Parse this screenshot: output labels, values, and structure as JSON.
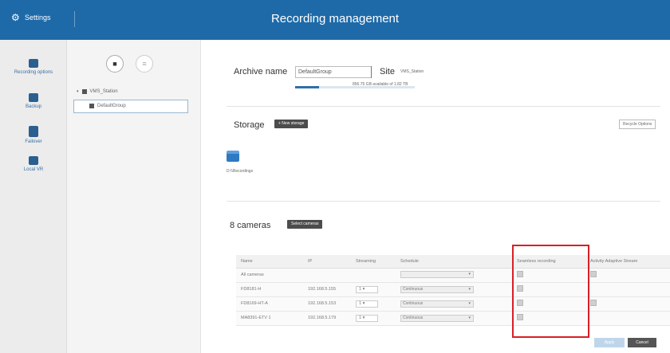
{
  "topbar": {
    "brand_label": "Settings",
    "title": "Recording management"
  },
  "sidebar": {
    "items": [
      {
        "label": "Recording options",
        "icon": "calendar-icon"
      },
      {
        "label": "Backup",
        "icon": "backup-icon"
      },
      {
        "label": "Failover",
        "icon": "failover-icon"
      },
      {
        "label": "Local VR",
        "icon": "local-vr-icon"
      }
    ]
  },
  "tree": {
    "add_btn": "■",
    "remove_btn": "≡",
    "station": "VMS_Station",
    "group": "DefaultGroup"
  },
  "archive": {
    "name_label": "Archive name",
    "name_value": "DefaultGroup",
    "site_label": "Site",
    "site_value": "VMS_Station",
    "usage_text": "856.75 GB available of 1.82 TB",
    "usage_fraction": 0.2
  },
  "storage": {
    "label": "Storage",
    "new_storage_btn": "+ New storage",
    "recycle_btn": "Recycle Options",
    "item_label": "D:\\\\Recordings"
  },
  "cameras": {
    "title": "8 cameras",
    "select_btn": "Select cameras",
    "columns": [
      "Name",
      "IP",
      "Streaming",
      "Schedule",
      "Seamless recording",
      "Activity Adaptive Stream"
    ],
    "all_row_label": "All cameras",
    "rows": [
      {
        "name": "FD8181-H",
        "ip": "192.168.5.155",
        "streaming": "1",
        "schedule": "Continuous",
        "aas": false
      },
      {
        "name": "FD8169-HT-A",
        "ip": "192.168.5.153",
        "streaming": "1",
        "schedule": "Continuous",
        "aas": true
      },
      {
        "name": "MA8391-ETV 1",
        "ip": "192.168.5.179",
        "streaming": "1",
        "schedule": "Continuous",
        "aas": false
      }
    ]
  },
  "footer": {
    "apply_btn": "Apply",
    "cancel_btn": "Cancel"
  },
  "colors": {
    "topbar": "#1e6aa8",
    "highlight": "#d91f26"
  }
}
